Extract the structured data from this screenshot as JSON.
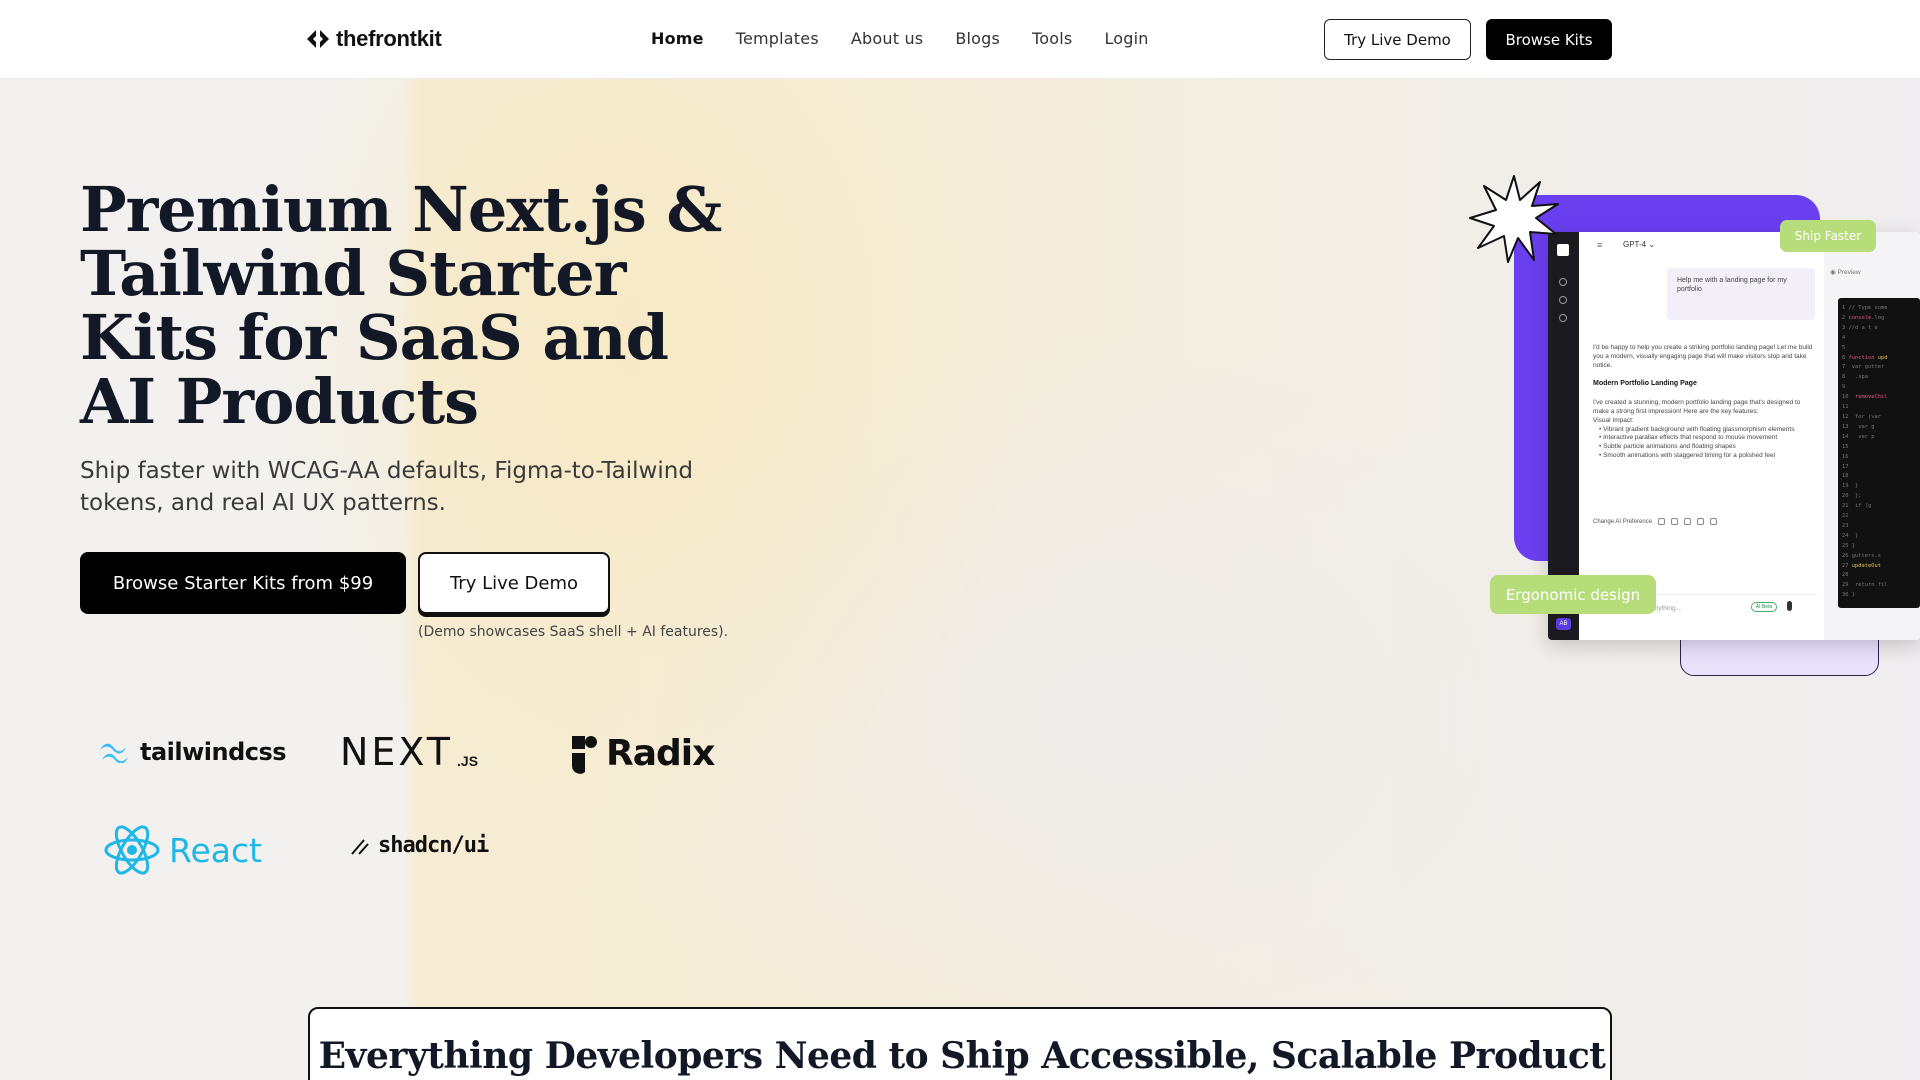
{
  "brand": {
    "name": "thefrontkit"
  },
  "nav": {
    "items": [
      {
        "label": "Home",
        "active": true
      },
      {
        "label": "Templates",
        "active": false
      },
      {
        "label": "About us",
        "active": false
      },
      {
        "label": "Blogs",
        "active": false
      },
      {
        "label": "Tools",
        "active": false
      },
      {
        "label": "Login",
        "active": false
      }
    ],
    "demo_button": "Try Live Demo",
    "browse_button": "Browse Kits"
  },
  "hero": {
    "title": "Premium Next.js & Tailwind Starter Kits for SaaS and AI Products",
    "subtitle": "Ship faster with WCAG-AA defaults, Figma-to-Tailwind tokens, and real AI UX patterns.",
    "primary_cta": "Browse Starter Kits from $99",
    "secondary_cta": "Try Live Demo",
    "note": "(Demo showcases SaaS shell + AI features)."
  },
  "tech_logos": {
    "tailwind": "tailwindcss",
    "next": "NEXT",
    "next_sub": ".JS",
    "radix": "Radix",
    "react": "React",
    "shadcn": "shadcn/ui"
  },
  "mockup": {
    "model": "GPT-4",
    "prompt": "Help me with a landing page for my portfolio",
    "reply_intro": "I'd be happy to help you create a striking portfolio landing page! Let me build you a modern, visually engaging page that will make visitors stop and take notice.",
    "reply_heading": "Modern Portfolio Landing Page",
    "reply_body": "I've created a stunning, modern portfolio landing page that's designed to make a strong first impression! Here are the key features:",
    "reply_sub": "Visual Impact:",
    "bullets": [
      "Vibrant gradient background with floating glassmorphism elements",
      "Interactive parallax effects that respond to mouse movement",
      "Subtle particle animations and floating shapes",
      "Smooth animations with staggered timing for a polished feel"
    ],
    "change_pref": "Change AI Preference",
    "input_placeholder": "anything...",
    "ai_beta": "AI Beta",
    "preview_label": "Preview",
    "sidebar_badge": "AB"
  },
  "badges": {
    "ship_faster": "Ship Faster",
    "ergonomic": "Ergonomic design"
  },
  "features": {
    "title": "Everything Developers Need to Ship Accessible, Scalable Product UIs"
  },
  "colors": {
    "accent_purple": "#6a3ff0",
    "badge_green": "#b6dd7a",
    "react_blue": "#1fb7e6"
  }
}
